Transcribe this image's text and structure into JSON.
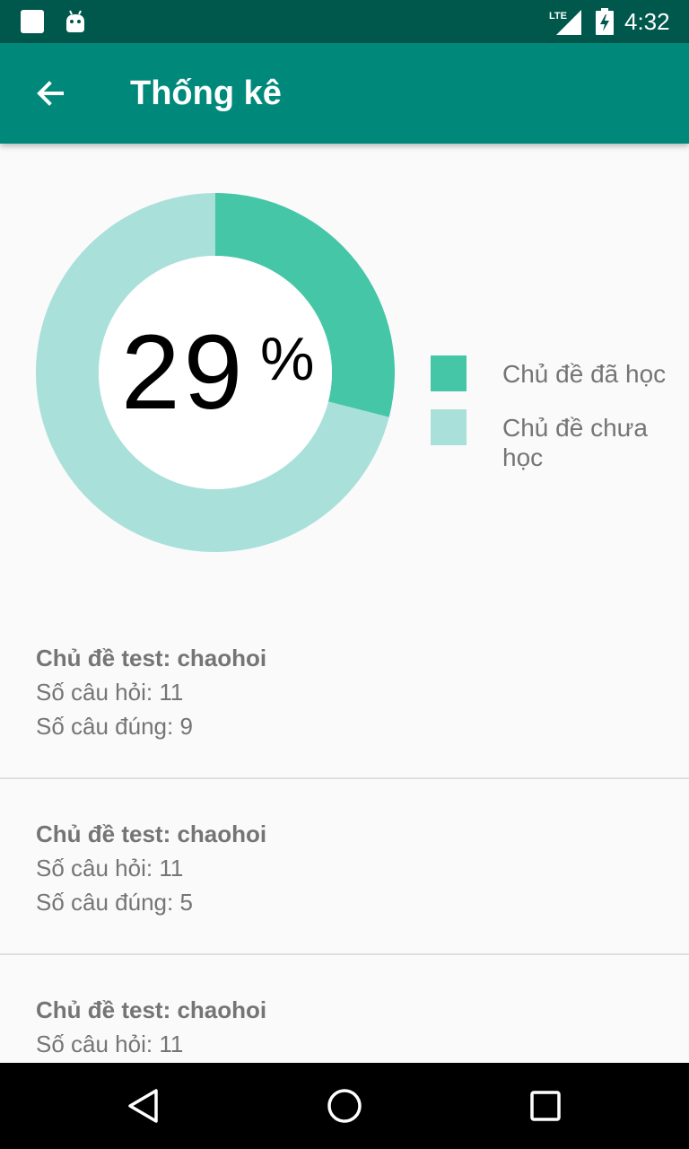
{
  "status_bar": {
    "time": "4:32",
    "network_label": "LTE",
    "icons": [
      "notification-square-icon",
      "android-debug-icon",
      "lte-signal-icon",
      "battery-charging-icon"
    ]
  },
  "app_bar": {
    "title": "Thống kê",
    "back_icon": "arrow-back-icon"
  },
  "chart": {
    "percent_value": "29",
    "percent_sign": "%"
  },
  "chart_data": {
    "type": "pie",
    "categories": [
      "Chủ đề đã học",
      "Chủ đề chưa học"
    ],
    "values": [
      29,
      71
    ],
    "center_label": "29%",
    "colors": [
      "#45c6a6",
      "#aae0da"
    ],
    "legend_position": "right"
  },
  "legend": [
    {
      "label": "Chủ đề đã học",
      "color": "#45c6a6"
    },
    {
      "label": "Chủ đề chưa học",
      "color": "#aae0da"
    }
  ],
  "topics": [
    {
      "title": "Chủ đề test: chaohoi",
      "questions": "Số câu hỏi: 11",
      "correct": "Số câu đúng: 9"
    },
    {
      "title": "Chủ đề test: chaohoi",
      "questions": "Số câu hỏi: 11",
      "correct": "Số câu đúng: 5"
    },
    {
      "title": "Chủ đề test: chaohoi",
      "questions": "Số câu hỏi: 11"
    }
  ],
  "nav_bar": {
    "icons": [
      "back-triangle-icon",
      "home-circle-icon",
      "recents-square-icon"
    ]
  },
  "colors": {
    "status_bar": "#00574b",
    "app_bar": "#00897b",
    "accent_done": "#45c6a6",
    "accent_remaining": "#aae0da"
  }
}
